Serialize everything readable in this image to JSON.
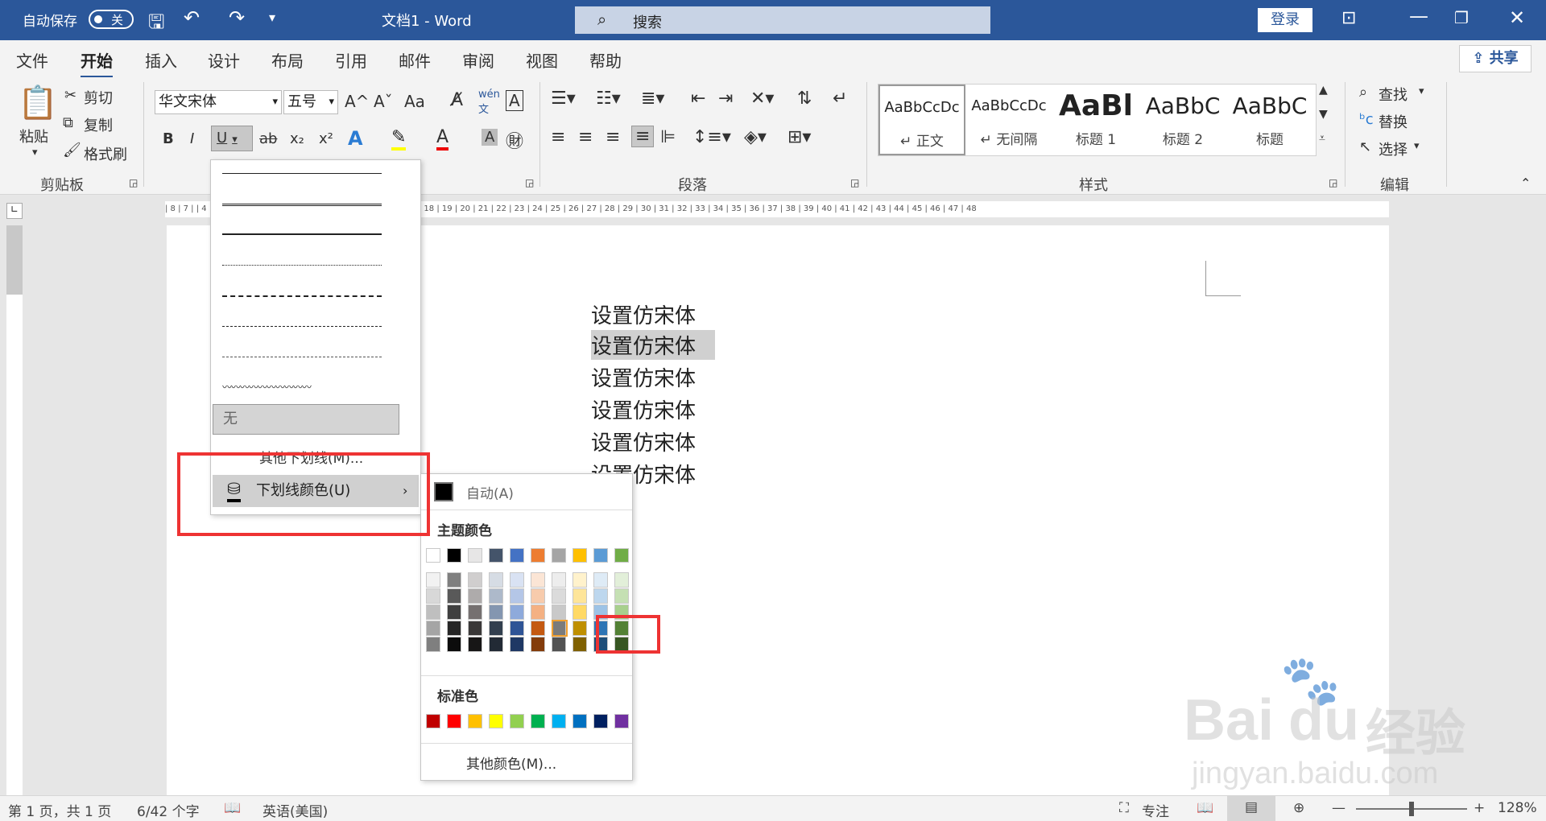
{
  "titlebar": {
    "autosave": "自动保存",
    "autosave_state": "关",
    "title": "文档1  -  Word",
    "search": "搜索",
    "login": "登录"
  },
  "menu": {
    "tabs": [
      "文件",
      "开始",
      "插入",
      "设计",
      "布局",
      "引用",
      "邮件",
      "审阅",
      "视图",
      "帮助"
    ],
    "active": "开始",
    "share": "共享"
  },
  "ribbon": {
    "clipboard": {
      "paste": "粘贴",
      "cut": "剪切",
      "copy": "复制",
      "format_painter": "格式刷",
      "label": "剪贴板"
    },
    "font": {
      "name": "华文宋体",
      "size": "五号",
      "grow": "A^",
      "shrink": "Aˇ",
      "case": "Aa",
      "bold": "B",
      "italic": "I",
      "underline": "U",
      "strike": "ab",
      "sub": "x₂",
      "sup": "x²"
    },
    "paragraph": {
      "label": "段落"
    },
    "styles": {
      "label": "样式",
      "items": [
        {
          "preview": "AaBbCcDc",
          "name": "↵ 正文"
        },
        {
          "preview": "AaBbCcDc",
          "name": "↵ 无间隔"
        },
        {
          "preview": "AaBl",
          "name": "标题 1"
        },
        {
          "preview": "AaBbC",
          "name": "标题 2"
        },
        {
          "preview": "AaBbC",
          "name": "标题"
        }
      ]
    },
    "editing": {
      "find": "查找",
      "replace": "替换",
      "select": "选择",
      "label": "编辑"
    }
  },
  "ruler": "| 8 | 7 |                                          | 4 | 5 | 6 | 7 | 8 | 9 | 10 | 11 | 12 | 13 | 14 | 15 | 16 | 17 | 18 | 19 | 20 | 21 | 22 | 23 | 24 | 25 | 26 | 27 | 28 | 29 | 30 | 31 | 32 | 33 | 34 | 35 | 36 | 37 | 38 | 39 | 40 | 41 | 42 | 43 | 44 | 45 | 46 | 47 | 48",
  "document": {
    "lines": [
      "设置仿宋体",
      "设置仿宋体",
      "设置仿宋体",
      "设置仿宋体",
      "设置仿宋体",
      "设置仿宋体"
    ]
  },
  "underline_menu": {
    "none": "无",
    "more": "其他下划线(M)...",
    "color": "下划线颜色(U)"
  },
  "color_panel": {
    "auto": "自动(A)",
    "theme_title": "主题颜色",
    "standard_title": "标准色",
    "more": "其他颜色(M)...",
    "theme_top": [
      "#ffffff",
      "#000000",
      "#e7e6e6",
      "#44546a",
      "#4472c4",
      "#ed7d31",
      "#a5a5a5",
      "#ffc000",
      "#5b9bd5",
      "#70ad47"
    ],
    "theme_shades": [
      [
        "#f2f2f2",
        "#7f7f7f",
        "#d0cece",
        "#d6dce4",
        "#d9e2f3",
        "#fbe5d5",
        "#ededed",
        "#fff2cc",
        "#deebf6",
        "#e2efd9"
      ],
      [
        "#d8d8d8",
        "#595959",
        "#aeabab",
        "#adb9ca",
        "#b4c6e7",
        "#f7cbac",
        "#dbdbdb",
        "#fee599",
        "#bdd7ee",
        "#c5e0b3"
      ],
      [
        "#bfbfbf",
        "#3f3f3f",
        "#757070",
        "#8496b0",
        "#8eaadb",
        "#f4b183",
        "#c9c9c9",
        "#ffd965",
        "#9dc3e6",
        "#a8d08d"
      ],
      [
        "#a5a5a5",
        "#262626",
        "#3a3838",
        "#323f4f",
        "#2f5496",
        "#c45911",
        "#7b7b7b",
        "#bf8f00",
        "#2e75b5",
        "#538135"
      ],
      [
        "#7f7f7f",
        "#0c0c0c",
        "#171616",
        "#222a35",
        "#1f3864",
        "#833c0b",
        "#525252",
        "#7f6000",
        "#1e4e79",
        "#375623"
      ]
    ],
    "standard": [
      "#c00000",
      "#ff0000",
      "#ffc000",
      "#ffff00",
      "#92d050",
      "#00b050",
      "#00b0f0",
      "#0070c0",
      "#002060",
      "#7030a0"
    ]
  },
  "status": {
    "page": "第 1 页，共 1 页",
    "words": "6/42 个字",
    "lang": "英语(美国)",
    "focus": "专注",
    "zoom": "128%"
  },
  "watermark": {
    "brand": "Bai",
    "brand2": "du",
    "cn": "经验",
    "url": "jingyan.baidu.com"
  }
}
